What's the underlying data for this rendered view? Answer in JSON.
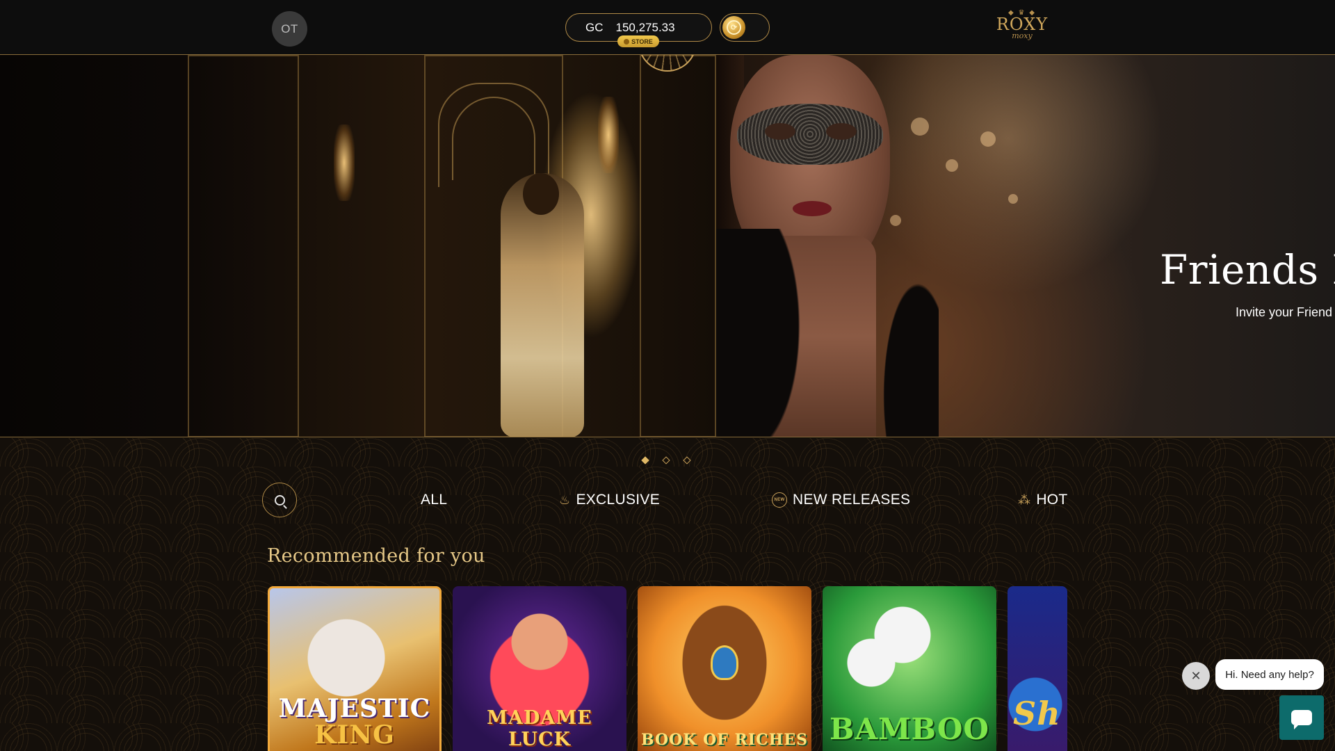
{
  "header": {
    "avatar_initials": "OT",
    "currency_label": "GC",
    "balance": "150,275.33",
    "store_label": "STORE",
    "coin_toggle_icon": "coin-icon",
    "logo": {
      "name": "ROXY",
      "sub": "moxy"
    }
  },
  "hero": {
    "title": "Friends De",
    "subtitle": "Invite your Friend",
    "carousel": {
      "count": 3,
      "active": 1
    }
  },
  "categories": {
    "search_icon": "search-icon",
    "tabs": [
      {
        "label": "ALL",
        "icon": ""
      },
      {
        "label": "EXCLUSIVE",
        "icon": "flame-icon"
      },
      {
        "label": "NEW RELEASES",
        "icon": "new-badge-icon",
        "badge": "NEW"
      },
      {
        "label": "HOT",
        "icon": "fire-icon"
      }
    ]
  },
  "recommended": {
    "title": "Recommended for you",
    "games": [
      {
        "line1": "MAJESTIC",
        "line2": "KING"
      },
      {
        "title": "MADAME LUCK"
      },
      {
        "title": "BOOK OF RICHES"
      },
      {
        "title": "BAMBOO"
      },
      {
        "title": "Sh"
      }
    ]
  },
  "chat": {
    "prompt": "Hi. Need any help?",
    "close_icon": "close-icon",
    "launcher_icon": "chat-icon"
  },
  "colors": {
    "accent_gold": "#c9a15a",
    "background": "#0f0b08",
    "chat_button": "#0d6b6b"
  }
}
